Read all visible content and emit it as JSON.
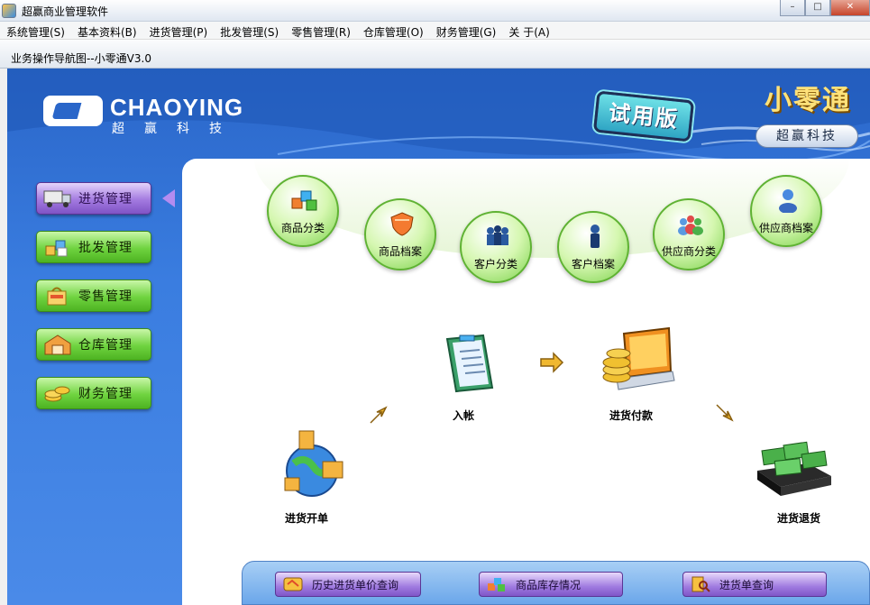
{
  "window": {
    "title": "超赢商业管理软件"
  },
  "menu": [
    "系统管理(S)",
    "基本资料(B)",
    "进货管理(P)",
    "批发管理(S)",
    "零售管理(R)",
    "仓库管理(O)",
    "财务管理(G)",
    "关 于(A)"
  ],
  "subwindow": {
    "title": "业务操作导航图--小零通V3.0"
  },
  "banner": {
    "brand": "CHAOYING",
    "brand_cn": "超赢科技",
    "trial_badge": "试用版",
    "product_name": "小零通",
    "product_sub": "超赢科技"
  },
  "sidebar": [
    {
      "label": "进货管理",
      "active": true,
      "icon": "truck-icon"
    },
    {
      "label": "批发管理",
      "active": false,
      "icon": "boxes-icon"
    },
    {
      "label": "零售管理",
      "active": false,
      "icon": "bag-icon"
    },
    {
      "label": "仓库管理",
      "active": false,
      "icon": "warehouse-icon"
    },
    {
      "label": "财务管理",
      "active": false,
      "icon": "coins-icon"
    }
  ],
  "basics": [
    {
      "label": "商品分类",
      "icon": "cubes-icon"
    },
    {
      "label": "商品档案",
      "icon": "shield-icon"
    },
    {
      "label": "客户分类",
      "icon": "group-icon"
    },
    {
      "label": "客户档案",
      "icon": "person-icon"
    },
    {
      "label": "供应商分类",
      "icon": "people-icon"
    },
    {
      "label": "供应商档案",
      "icon": "user-icon"
    }
  ],
  "flow": {
    "open_order": "进货开单",
    "post": "入帐",
    "payment": "进货付款",
    "return": "进货退货"
  },
  "bottom": [
    {
      "label": "历史进货单价查询",
      "icon": "history-icon"
    },
    {
      "label": "商品库存情况",
      "icon": "stock-icon"
    },
    {
      "label": "进货单查询",
      "icon": "search-doc-icon"
    }
  ],
  "colors": {
    "main_blue": "#3a7de0",
    "button_green": "#6fd33f",
    "button_purple": "#a37ae0",
    "accent_gold": "#ffe27a"
  }
}
